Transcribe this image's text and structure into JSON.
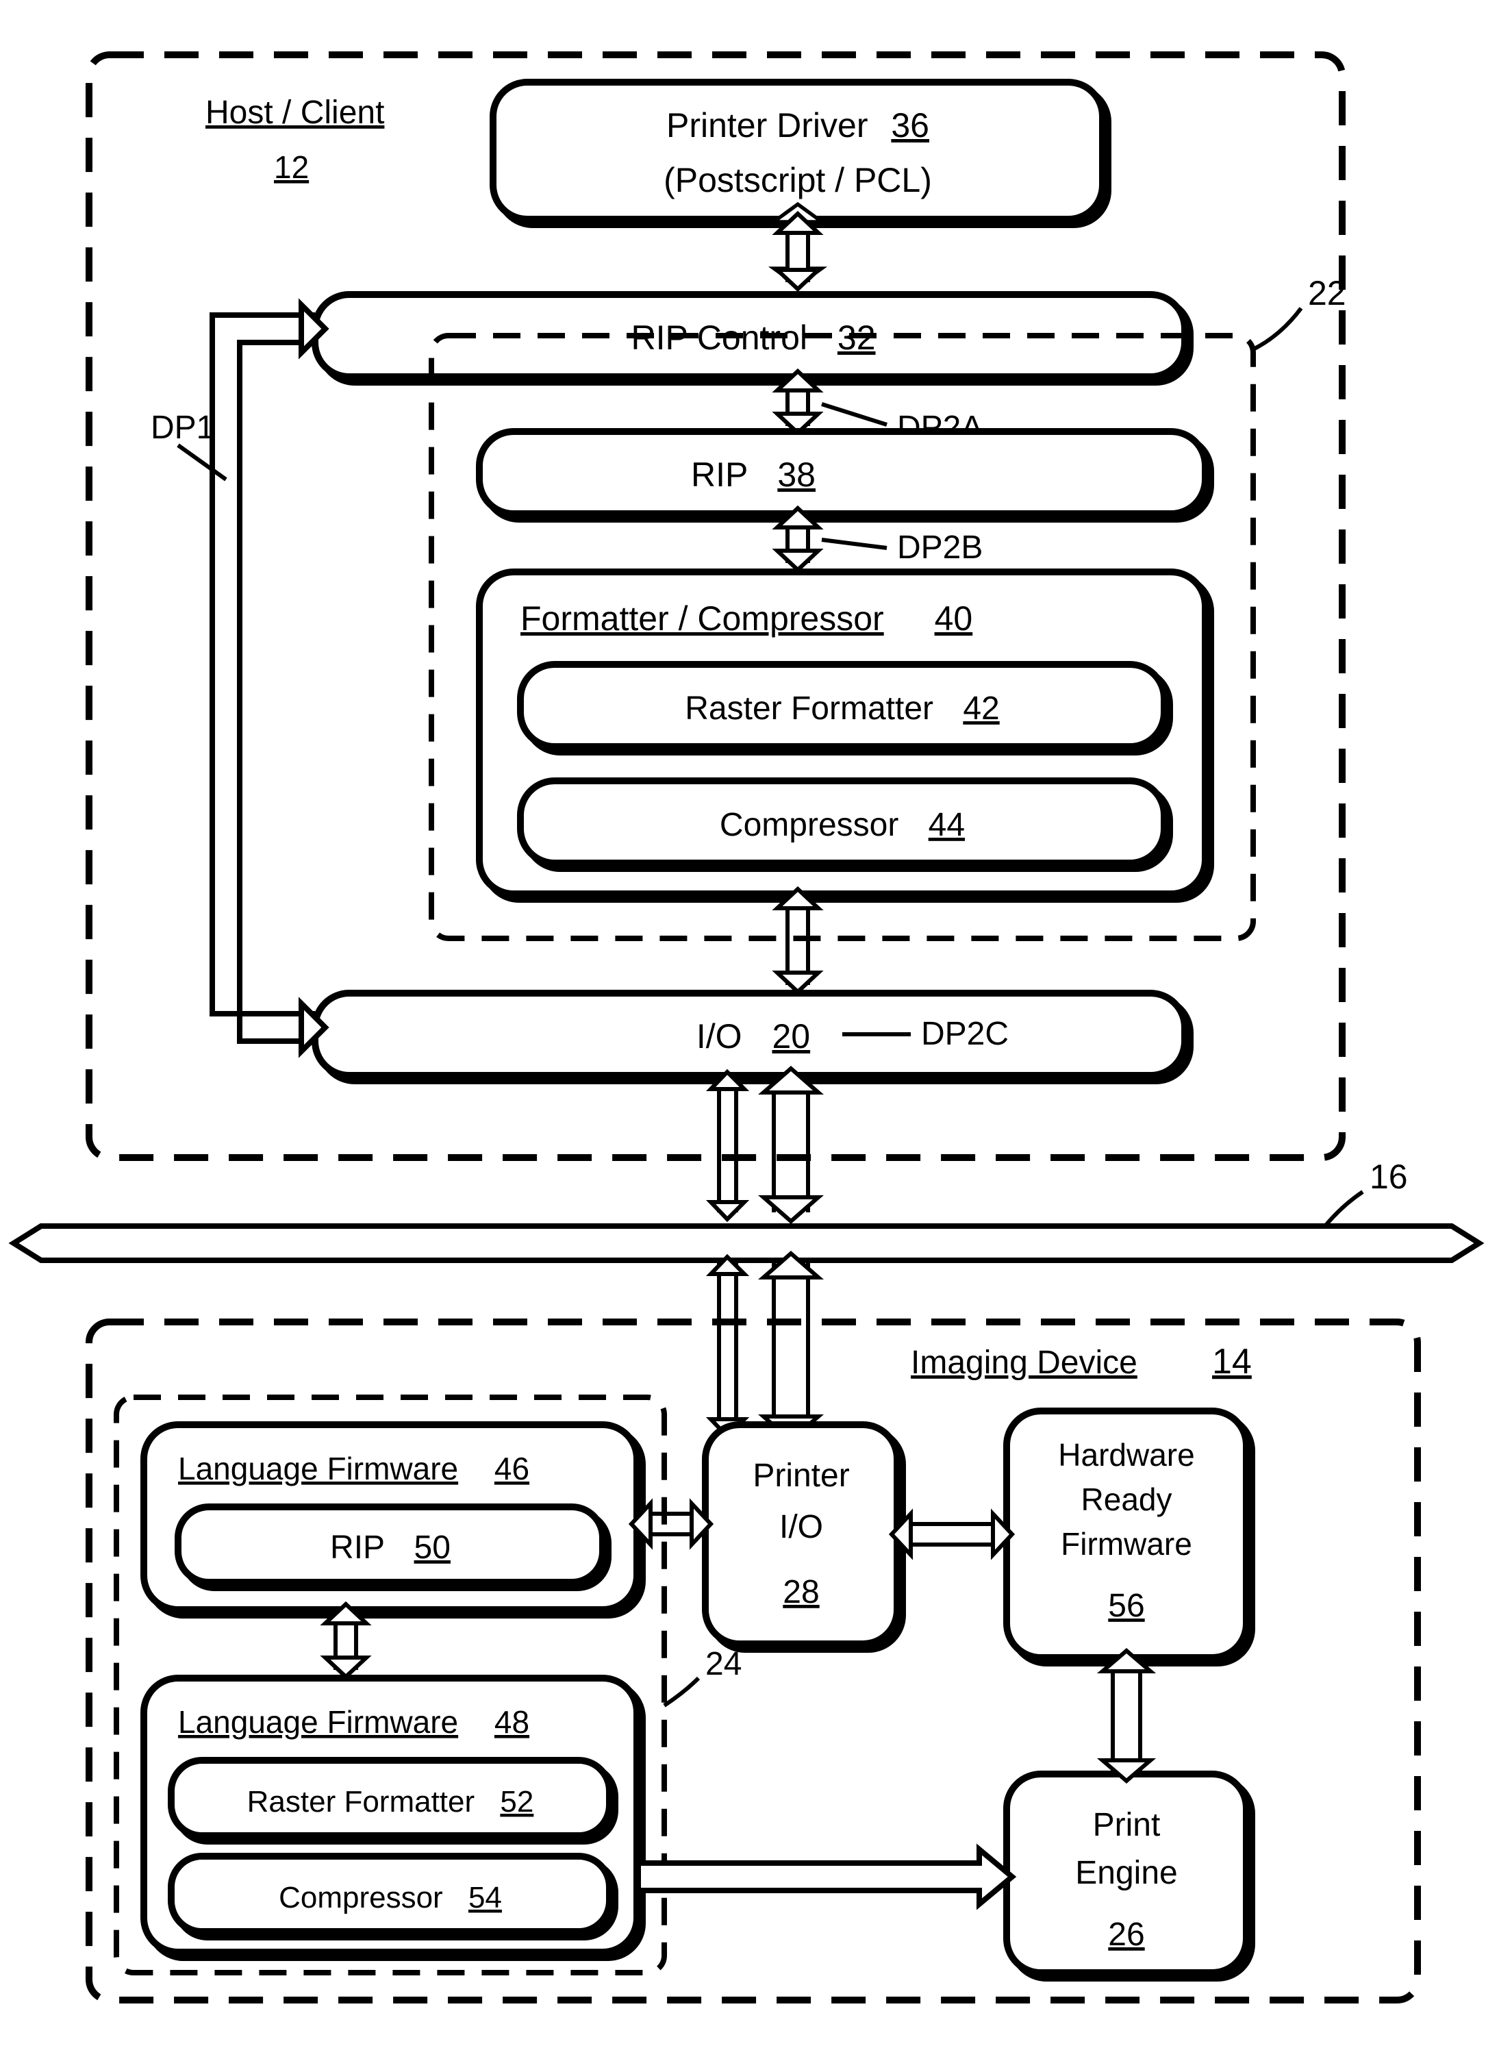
{
  "host": {
    "title": "Host / Client",
    "ref": "12",
    "driver": {
      "line1": "Printer Driver",
      "ref": "36",
      "line2": "(Postscript / PCL)"
    },
    "ripControl": {
      "label": "RIP Control",
      "ref": "32"
    },
    "rip": {
      "label": "RIP",
      "ref": "38"
    },
    "formatter": {
      "title": "Formatter / Compressor",
      "ref": "40",
      "raster": {
        "label": "Raster Formatter",
        "ref": "42"
      },
      "compressor": {
        "label": "Compressor",
        "ref": "44"
      }
    },
    "io": {
      "label": "I/O",
      "ref": "20"
    },
    "dashGroupRef": "22",
    "dp1": "DP1",
    "dp2a": "DP2A",
    "dp2b": "DP2B",
    "dp2c": "DP2C"
  },
  "bus": {
    "ref": "16"
  },
  "imaging": {
    "title": "Imaging Device",
    "ref": "14",
    "dashGroupRef": "24",
    "lang1": {
      "title": "Language Firmware",
      "ref": "46",
      "rip": {
        "label": "RIP",
        "ref": "50"
      }
    },
    "lang2": {
      "title": "Language Firmware",
      "ref": "48",
      "raster": {
        "label": "Raster Formatter",
        "ref": "52"
      },
      "compressor": {
        "label": "Compressor",
        "ref": "54"
      }
    },
    "printerIO": {
      "line1": "Printer",
      "line2": "I/O",
      "ref": "28"
    },
    "hardwareReady": {
      "line1": "Hardware",
      "line2": "Ready",
      "line3": "Firmware",
      "ref": "56"
    },
    "printEngine": {
      "line1": "Print",
      "line2": "Engine",
      "ref": "26"
    }
  }
}
